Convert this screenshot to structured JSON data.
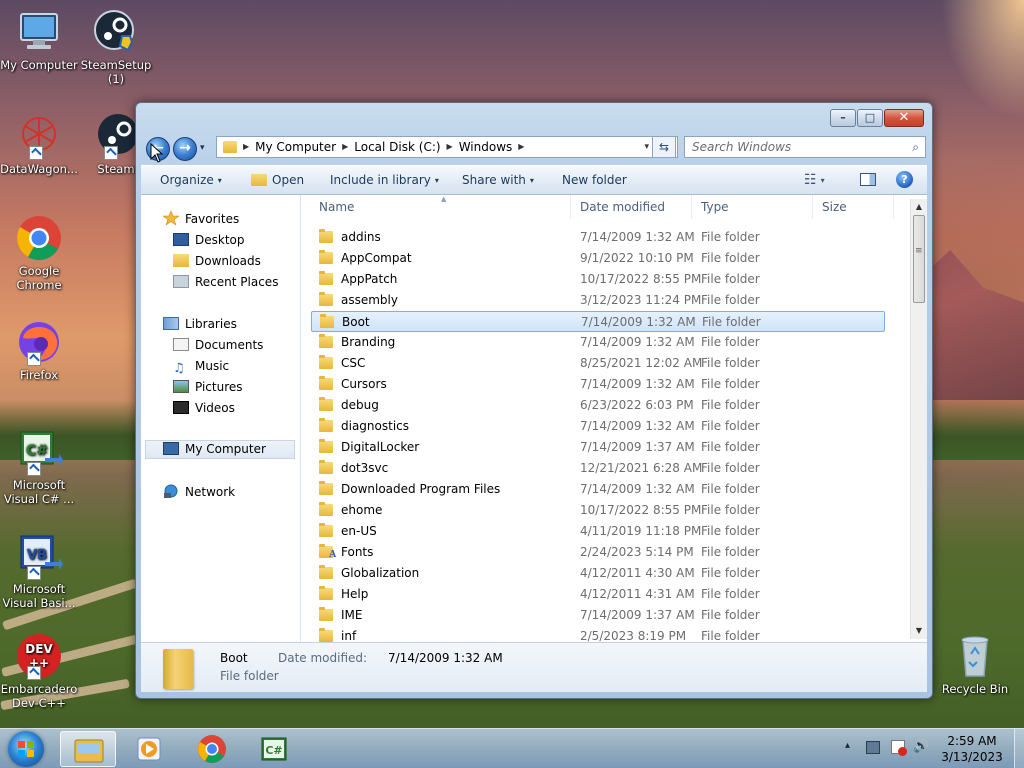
{
  "desktop": {
    "icons": [
      {
        "label": "My Computer",
        "icon": "computer-icon"
      },
      {
        "label": "SteamSetup (1)",
        "icon": "steam-setup-icon"
      },
      {
        "label": "DataWagon...",
        "icon": "datawagon-icon"
      },
      {
        "label": "Steam",
        "icon": "steam-icon"
      },
      {
        "label": "Google Chrome",
        "icon": "chrome-icon"
      },
      {
        "label": "Firefox",
        "icon": "firefox-icon"
      },
      {
        "label": "Microsoft Visual C# ...",
        "icon": "visual-csharp-icon"
      },
      {
        "label": "Microsoft Visual Basi...",
        "icon": "visual-basic-icon"
      },
      {
        "label": "Embarcadero Dev-C++",
        "icon": "devcpp-icon"
      },
      {
        "label": "Recycle Bin",
        "icon": "recycle-bin-icon"
      }
    ]
  },
  "window": {
    "controls": {
      "minimize": "–",
      "maximize": "□",
      "close": "✕"
    },
    "nav": {
      "back": "←",
      "forward": "→",
      "recent": "▾"
    },
    "address": {
      "segments": [
        "My Computer",
        "Local Disk (C:)",
        "Windows"
      ],
      "separator": "▶",
      "dropdown": "▾"
    },
    "refresh_glyph": "⇆",
    "search": {
      "placeholder": "Search Windows",
      "icon": "⌕"
    },
    "toolbar": {
      "organize": "Organize",
      "open": "Open",
      "include_in_library": "Include in library",
      "share_with": "Share with",
      "new_folder": "New folder",
      "dropdown_arrow": "▾",
      "views_glyph": "☷",
      "help": "?"
    },
    "nav_pane": {
      "favorites": "Favorites",
      "desktop": "Desktop",
      "downloads": "Downloads",
      "recent_places": "Recent Places",
      "libraries": "Libraries",
      "documents": "Documents",
      "music": "Music",
      "pictures": "Pictures",
      "videos": "Videos",
      "my_computer": "My Computer",
      "network": "Network"
    },
    "columns": {
      "name": "Name",
      "date_modified": "Date modified",
      "type": "Type",
      "size": "Size"
    },
    "files": [
      {
        "name": "addins",
        "date": "7/14/2009 1:32 AM",
        "type": "File folder"
      },
      {
        "name": "AppCompat",
        "date": "9/1/2022 10:10 PM",
        "type": "File folder"
      },
      {
        "name": "AppPatch",
        "date": "10/17/2022 8:55 PM",
        "type": "File folder"
      },
      {
        "name": "assembly",
        "date": "3/12/2023 11:24 PM",
        "type": "File folder"
      },
      {
        "name": "Boot",
        "date": "7/14/2009 1:32 AM",
        "type": "File folder",
        "selected": true
      },
      {
        "name": "Branding",
        "date": "7/14/2009 1:32 AM",
        "type": "File folder"
      },
      {
        "name": "CSC",
        "date": "8/25/2021 12:02 AM",
        "type": "File folder"
      },
      {
        "name": "Cursors",
        "date": "7/14/2009 1:32 AM",
        "type": "File folder"
      },
      {
        "name": "debug",
        "date": "6/23/2022 6:03 PM",
        "type": "File folder"
      },
      {
        "name": "diagnostics",
        "date": "7/14/2009 1:32 AM",
        "type": "File folder"
      },
      {
        "name": "DigitalLocker",
        "date": "7/14/2009 1:37 AM",
        "type": "File folder"
      },
      {
        "name": "dot3svc",
        "date": "12/21/2021 6:28 AM",
        "type": "File folder"
      },
      {
        "name": "Downloaded Program Files",
        "date": "7/14/2009 1:32 AM",
        "type": "File folder"
      },
      {
        "name": "ehome",
        "date": "10/17/2022 8:55 PM",
        "type": "File folder"
      },
      {
        "name": "en-US",
        "date": "4/11/2019 11:18 PM",
        "type": "File folder"
      },
      {
        "name": "Fonts",
        "date": "2/24/2023 5:14 PM",
        "type": "File folder",
        "fonts": true
      },
      {
        "name": "Globalization",
        "date": "4/12/2011 4:30 AM",
        "type": "File folder"
      },
      {
        "name": "Help",
        "date": "4/12/2011 4:31 AM",
        "type": "File folder"
      },
      {
        "name": "IME",
        "date": "7/14/2009 1:37 AM",
        "type": "File folder"
      },
      {
        "name": "inf",
        "date": "2/5/2023 8:19 PM",
        "type": "File folder"
      }
    ],
    "details": {
      "name": "Boot",
      "type": "File folder",
      "date_label": "Date modified:",
      "date_value": "7/14/2009 1:32 AM"
    },
    "scroll": {
      "up": "▲",
      "down": "▼",
      "grip": "≡"
    }
  },
  "taskbar": {
    "apps": [
      {
        "name": "explorer",
        "active": true
      },
      {
        "name": "media-player",
        "active": false
      },
      {
        "name": "chrome",
        "active": false
      },
      {
        "name": "visual-csharp",
        "active": false
      }
    ],
    "tray": {
      "show_hidden": "▴"
    },
    "clock": {
      "time": "2:59 AM",
      "date": "3/13/2023"
    }
  }
}
